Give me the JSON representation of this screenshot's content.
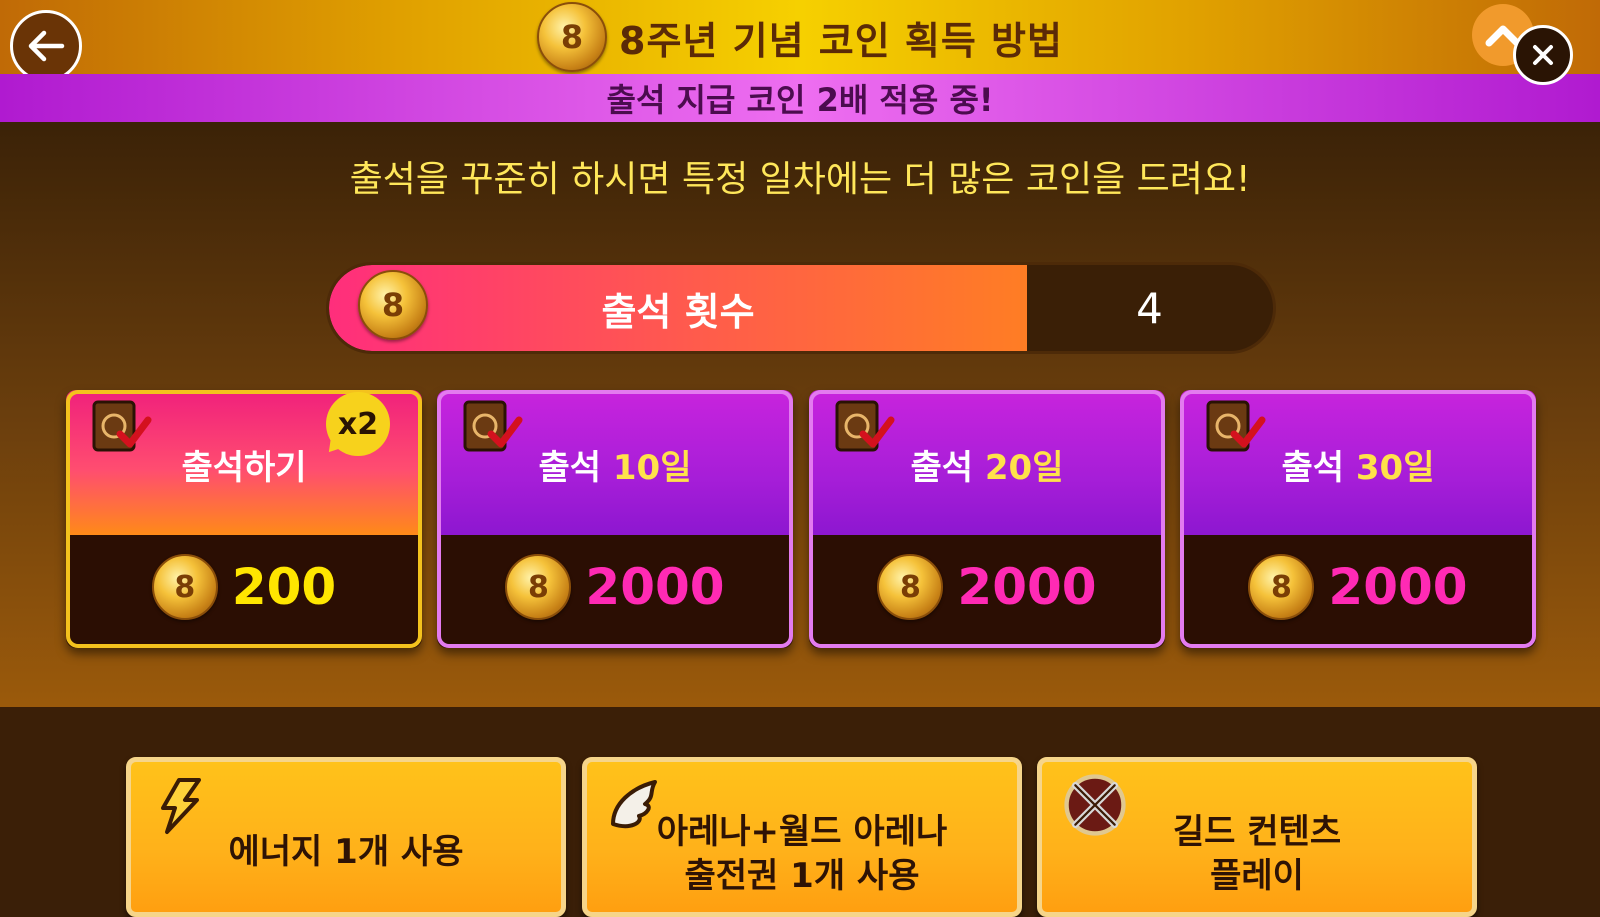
{
  "header": {
    "title": "8주년 기념 코인 획득 방법",
    "coin_symbol": "8",
    "back_icon": "back-arrow-icon",
    "close_icon": "close-icon",
    "collapse_icon": "chevron-up-icon"
  },
  "banner": {
    "text": "출석 지급 코인 2배 적용 중!"
  },
  "subtitle": "출석을 꾸준히 하시면 특정 일차에는 더 많은 코인을 드려요!",
  "attendance_counter": {
    "label": "출석 횟수",
    "value": "4"
  },
  "cards": [
    {
      "title": "출석하기",
      "title_highlight": "",
      "reward": "200",
      "badge": "x2"
    },
    {
      "title": "출석 ",
      "title_highlight": "10일",
      "reward": "2000"
    },
    {
      "title": "출석 ",
      "title_highlight": "20일",
      "reward": "2000"
    },
    {
      "title": "출석 ",
      "title_highlight": "30일",
      "reward": "2000"
    }
  ],
  "actions": [
    {
      "line1": "에너지 1개 사용",
      "line2": "",
      "icon": "lightning-icon"
    },
    {
      "line1": "아레나+월드 아레나",
      "line2": "출전권 1개 사용",
      "icon": "wing-icon"
    },
    {
      "line1": "길드 컨텐츠",
      "line2": "플레이",
      "icon": "guild-swords-icon"
    }
  ],
  "colors": {
    "title_bar": "#f6d000",
    "banner": "#ee6ef0",
    "first_card_border": "#f4c21d",
    "purple_card_border": "#e37bef",
    "highlight_yellow": "#ffe24a",
    "reward_pink": "#ff2ab4",
    "action_button": "#ffb11a"
  }
}
